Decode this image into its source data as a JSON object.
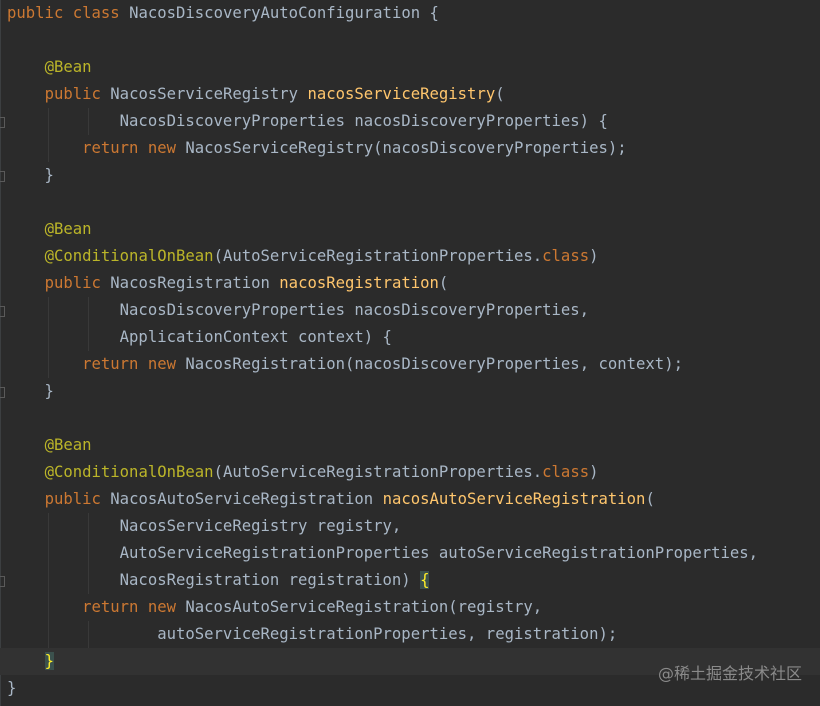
{
  "colors": {
    "background": "#2b2b2b",
    "keyword": "#cc7832",
    "annotation": "#bbb529",
    "method_name": "#ffc66d",
    "identifier": "#a9b7c6",
    "brace_match": "#ffef28",
    "current_line": "#323232"
  },
  "editor": {
    "current_line_index": 24,
    "lines": [
      [
        [
          "kw",
          "public"
        ],
        [
          "id",
          " "
        ],
        [
          "kw",
          "class"
        ],
        [
          "id",
          " NacosDiscoveryAutoConfiguration {"
        ]
      ],
      [],
      [
        [
          "id",
          "    "
        ],
        [
          "ann",
          "@Bean"
        ]
      ],
      [
        [
          "id",
          "    "
        ],
        [
          "kw",
          "public"
        ],
        [
          "id",
          " NacosServiceRegistry "
        ],
        [
          "fn",
          "nacosServiceRegistry"
        ],
        [
          "id",
          "("
        ]
      ],
      [
        [
          "id",
          "            NacosDiscoveryProperties nacosDiscoveryProperties) {"
        ]
      ],
      [
        [
          "id",
          "        "
        ],
        [
          "kw",
          "return new"
        ],
        [
          "id",
          " NacosServiceRegistry(nacosDiscoveryProperties);"
        ]
      ],
      [
        [
          "id",
          "    }"
        ]
      ],
      [],
      [
        [
          "id",
          "    "
        ],
        [
          "ann",
          "@Bean"
        ]
      ],
      [
        [
          "id",
          "    "
        ],
        [
          "ann",
          "@ConditionalOnBean"
        ],
        [
          "id",
          "(AutoServiceRegistrationProperties."
        ],
        [
          "kw",
          "class"
        ],
        [
          "id",
          ")"
        ]
      ],
      [
        [
          "id",
          "    "
        ],
        [
          "kw",
          "public"
        ],
        [
          "id",
          " NacosRegistration "
        ],
        [
          "fn",
          "nacosRegistration"
        ],
        [
          "id",
          "("
        ]
      ],
      [
        [
          "id",
          "            NacosDiscoveryProperties nacosDiscoveryProperties,"
        ]
      ],
      [
        [
          "id",
          "            ApplicationContext context) {"
        ]
      ],
      [
        [
          "id",
          "        "
        ],
        [
          "kw",
          "return new"
        ],
        [
          "id",
          " NacosRegistration(nacosDiscoveryProperties, context);"
        ]
      ],
      [
        [
          "id",
          "    }"
        ]
      ],
      [],
      [
        [
          "id",
          "    "
        ],
        [
          "ann",
          "@Bean"
        ]
      ],
      [
        [
          "id",
          "    "
        ],
        [
          "ann",
          "@ConditionalOnBean"
        ],
        [
          "id",
          "(AutoServiceRegistrationProperties."
        ],
        [
          "kw",
          "class"
        ],
        [
          "id",
          ")"
        ]
      ],
      [
        [
          "id",
          "    "
        ],
        [
          "kw",
          "public"
        ],
        [
          "id",
          " NacosAutoServiceRegistration "
        ],
        [
          "fn",
          "nacosAutoServiceRegistration"
        ],
        [
          "id",
          "("
        ]
      ],
      [
        [
          "id",
          "            NacosServiceRegistry registry,"
        ]
      ],
      [
        [
          "id",
          "            AutoServiceRegistrationProperties autoServiceRegistrationProperties,"
        ]
      ],
      [
        [
          "id",
          "            NacosRegistration registration) "
        ],
        [
          "brace",
          "{"
        ]
      ],
      [
        [
          "id",
          "        "
        ],
        [
          "kw",
          "return new"
        ],
        [
          "id",
          " NacosAutoServiceRegistration(registry,"
        ]
      ],
      [
        [
          "id",
          "                autoServiceRegistrationProperties, registration);"
        ]
      ],
      [
        [
          "id",
          "    "
        ],
        [
          "brace",
          "}"
        ]
      ],
      [
        [
          "id",
          "}"
        ]
      ]
    ]
  },
  "watermark": "@稀土掘金技术社区"
}
